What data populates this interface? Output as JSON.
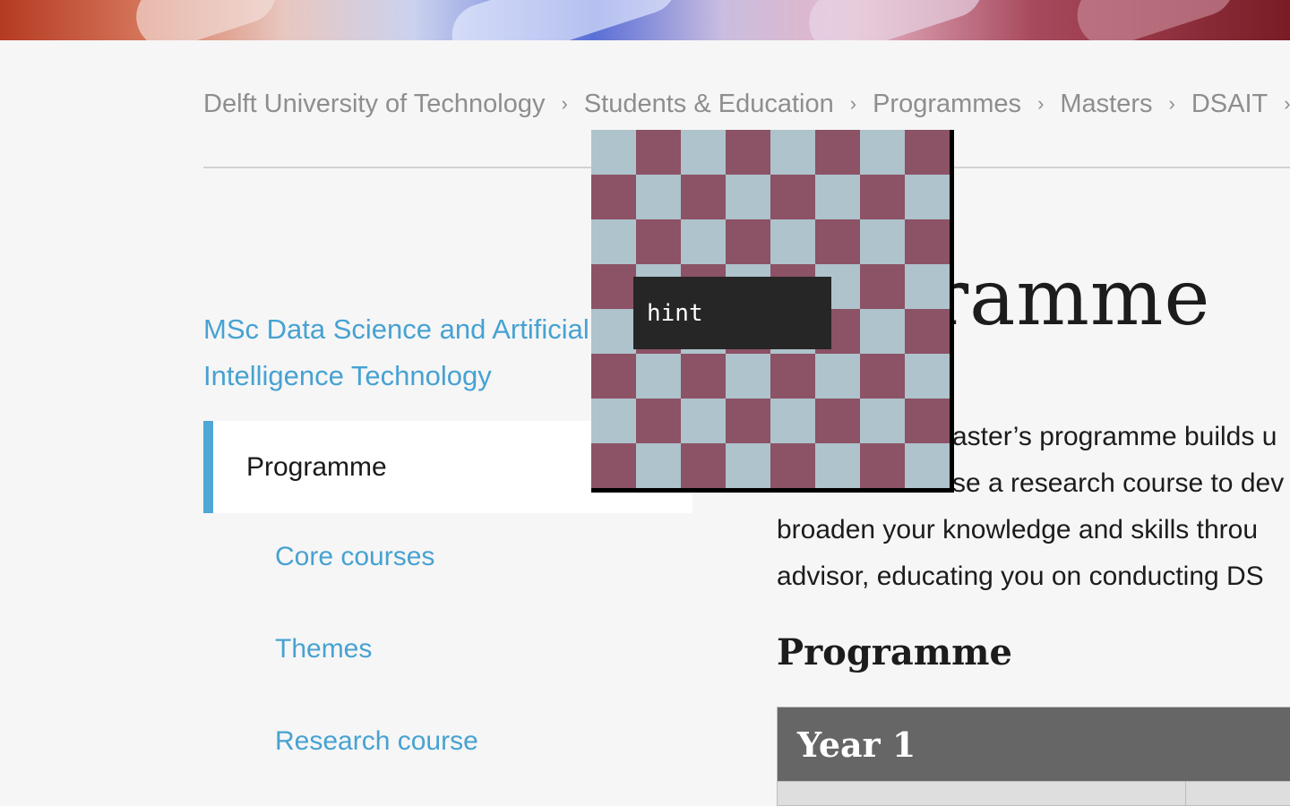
{
  "breadcrumb": {
    "items": [
      "Delft University of Technology",
      "Students & Education",
      "Programmes",
      "Masters",
      "DSAIT"
    ],
    "separator": "›"
  },
  "sidebar": {
    "title": "MSc Data Science and Artificial Intelligence Technology",
    "active_item": "Programme",
    "sub_items": [
      "Core courses",
      "Themes",
      "Research course"
    ]
  },
  "main": {
    "heading_visible": "ramme",
    "intro_lines": [
      "aster’s programme builds u",
      "se a research course to dev",
      "broaden your knowledge and skills throu",
      "advisor, educating you on conducting DS"
    ],
    "section_heading": "Programme",
    "table_header": "Year 1"
  },
  "overlay": {
    "hint_text": "hint",
    "checker_colors": [
      "#aec3cb",
      "#8c5266"
    ]
  },
  "colors": {
    "accent": "#4fa7d6",
    "link": "#47a2d2",
    "table_header_bg": "#666666"
  }
}
